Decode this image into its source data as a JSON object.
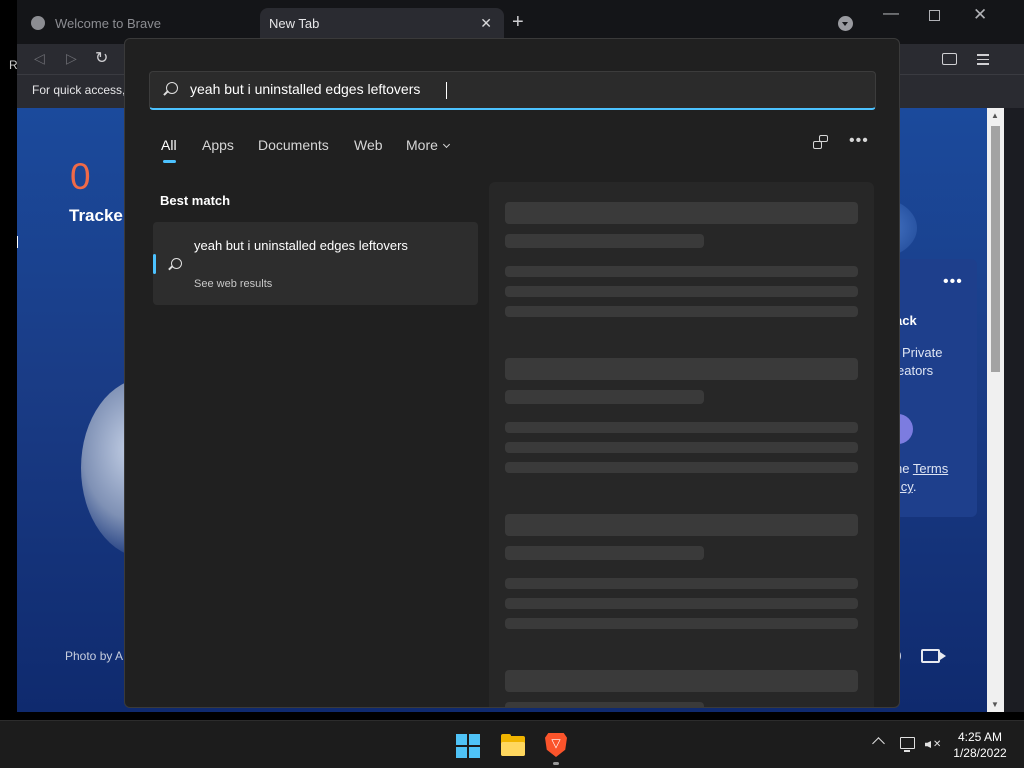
{
  "browser": {
    "tabs": [
      {
        "label": "Welcome to Brave"
      },
      {
        "label": "New Tab"
      }
    ],
    "bookmarks_hint": "For quick access, |",
    "left_fragment": "R",
    "ntp": {
      "trackers_count": "0",
      "trackers_label": "Tracke",
      "photo_credit": "Photo by A",
      "card": {
        "dots": "•••",
        "title": "ack",
        "line1": "Private",
        "line2": "eators",
        "terms_line1_prefix": "he ",
        "terms_line1_link": "Terms",
        "terms_line2_link": "licy",
        "terms_line2_suffix": "."
      }
    }
  },
  "search": {
    "query": "yeah but i uninstalled edges leftovers",
    "tabs": {
      "all": "All",
      "apps": "Apps",
      "documents": "Documents",
      "web": "Web",
      "more": "More"
    },
    "more_options": "•••",
    "best_match_label": "Best match",
    "result": {
      "title": "yeah but i uninstalled edges leftovers",
      "subtitle": "See web results"
    },
    "accent_color": "#4cc2ff"
  },
  "taskbar": {
    "time": "4:25 AM",
    "date": "1/28/2022",
    "icons": [
      "start-icon",
      "file-explorer-icon",
      "brave-icon",
      "chevron-up-icon",
      "network-icon",
      "volume-muted-icon"
    ]
  }
}
